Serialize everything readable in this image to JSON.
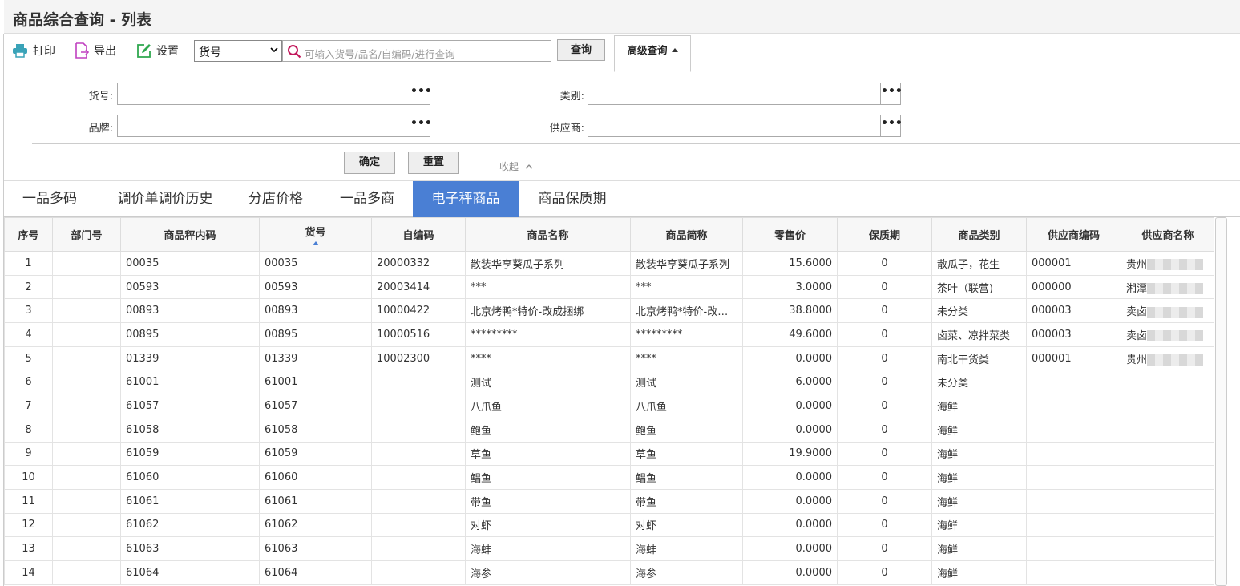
{
  "title": "商品综合查询 - 列表",
  "toolbar": {
    "print_label": "打印",
    "export_label": "导出",
    "settings_label": "设置",
    "field_select": "货号",
    "search_placeholder": "可输入货号/品名/自编码/进行查询",
    "query_label": "查询",
    "advanced_label": "高级查询"
  },
  "form": {
    "item_no_label": "货号:",
    "category_label": "类别:",
    "brand_label": "品牌:",
    "supplier_label": "供应商:",
    "ellipsis": "•••",
    "confirm_label": "确定",
    "reset_label": "重置",
    "collapse_label": "收起"
  },
  "tabs": [
    {
      "label": "一品多码",
      "active": false
    },
    {
      "label": "调价单调价历史",
      "active": false
    },
    {
      "label": "分店价格",
      "active": false
    },
    {
      "label": "一品多商",
      "active": false
    },
    {
      "label": "电子秤商品",
      "active": true
    },
    {
      "label": "商品保质期",
      "active": false
    }
  ],
  "table": {
    "columns": [
      "序号",
      "部门号",
      "商品秤内码",
      "货号",
      "自编码",
      "商品名称",
      "商品简称",
      "零售价",
      "保质期",
      "商品类别",
      "供应商编码",
      "供应商名称"
    ],
    "sorted_column": "货号",
    "rows": [
      [
        "1",
        "",
        "00035",
        "00035",
        "20000332",
        "散装华亨葵瓜子系列",
        "散装华亨葵瓜子系列",
        "15.6000",
        "0",
        "散瓜子，花生",
        "000001",
        "贵州"
      ],
      [
        "2",
        "",
        "00593",
        "00593",
        "20003414",
        "***",
        "***",
        "3.0000",
        "0",
        "茶叶（联营)",
        "000000",
        "湘潭"
      ],
      [
        "3",
        "",
        "00893",
        "00893",
        "10000422",
        "北京烤鸭*特价-改成捆绑",
        "北京烤鸭*特价-改成...",
        "38.8000",
        "0",
        "未分类",
        "000003",
        "卖卤"
      ],
      [
        "4",
        "",
        "00895",
        "00895",
        "10000516",
        "*********",
        "*********",
        "49.6000",
        "0",
        "卤菜、凉拌菜类",
        "000003",
        "卖卤"
      ],
      [
        "5",
        "",
        "01339",
        "01339",
        "10002300",
        "****",
        "****",
        "0.0000",
        "0",
        "南北干货类",
        "000001",
        "贵州"
      ],
      [
        "6",
        "",
        "61001",
        "61001",
        "",
        "测试",
        "测试",
        "6.0000",
        "0",
        "未分类",
        "",
        ""
      ],
      [
        "7",
        "",
        "61057",
        "61057",
        "",
        "八爪鱼",
        "八爪鱼",
        "0.0000",
        "0",
        "海鲜",
        "",
        ""
      ],
      [
        "8",
        "",
        "61058",
        "61058",
        "",
        "鲍鱼",
        "鲍鱼",
        "0.0000",
        "0",
        "海鲜",
        "",
        ""
      ],
      [
        "9",
        "",
        "61059",
        "61059",
        "",
        "草鱼",
        "草鱼",
        "19.9000",
        "0",
        "海鲜",
        "",
        ""
      ],
      [
        "10",
        "",
        "61060",
        "61060",
        "",
        "鲳鱼",
        "鲳鱼",
        "0.0000",
        "0",
        "海鲜",
        "",
        ""
      ],
      [
        "11",
        "",
        "61061",
        "61061",
        "",
        "带鱼",
        "带鱼",
        "0.0000",
        "0",
        "海鲜",
        "",
        ""
      ],
      [
        "12",
        "",
        "61062",
        "61062",
        "",
        "对虾",
        "对虾",
        "0.0000",
        "0",
        "海鲜",
        "",
        ""
      ],
      [
        "13",
        "",
        "61063",
        "61063",
        "",
        "海蚌",
        "海蚌",
        "0.0000",
        "0",
        "海鲜",
        "",
        ""
      ],
      [
        "14",
        "",
        "61064",
        "61064",
        "",
        "海参",
        "海参",
        "0.0000",
        "0",
        "海鲜",
        "",
        ""
      ]
    ]
  },
  "colors": {
    "accent": "#4a7fd4",
    "print_icon": "#3aa3b8",
    "export_icon": "#c040c0",
    "settings_icon": "#2fa84f",
    "search_icon": "#c2185b"
  }
}
